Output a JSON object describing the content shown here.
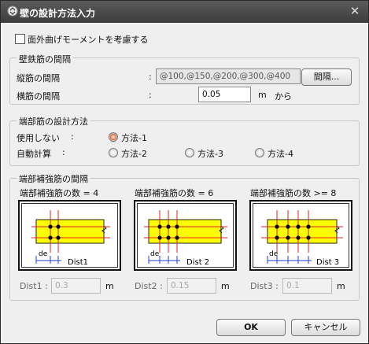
{
  "window": {
    "title": "壁の設計方法入力",
    "close_glyph": "✕"
  },
  "out_of_plane": {
    "label": "面外曲げモーメントを考慮する",
    "checked": false
  },
  "wall_rebar": {
    "group_title": "壁鉄筋の間隔",
    "vertical": {
      "label": "縦筋の間隔",
      "colon": ":",
      "value": "@100,@150,@200,@300,@400",
      "button": "間隔..."
    },
    "horizontal": {
      "label": "横筋の間隔",
      "colon": ":",
      "value": "0.05",
      "unit": "m",
      "suffix": "から"
    }
  },
  "end_rebar_design": {
    "group_title": "端部筋の設計方法",
    "manual": {
      "label": "使用しない",
      "colon": ":"
    },
    "auto": {
      "label": "自動計算",
      "colon": ":"
    },
    "methods": [
      {
        "label": "方法-1",
        "selected": true
      },
      {
        "label": "方法-2",
        "selected": false
      },
      {
        "label": "方法-3",
        "selected": false
      },
      {
        "label": "方法-4",
        "selected": false
      }
    ]
  },
  "end_reinforce_spacing": {
    "group_title": "端部補強筋の間隔",
    "cases": [
      {
        "caption": "端部補強筋の数 = 4",
        "de": "de",
        "dist_label": "Dist1",
        "field_label": "Dist1 :",
        "value": "0.3",
        "unit": "m"
      },
      {
        "caption": "端部補強筋の数 = 6",
        "de": "de",
        "dist_label": "Dist 2",
        "field_label": "Dist2 :",
        "value": "0.15",
        "unit": "m"
      },
      {
        "caption": "端部補強筋の数 >= 8",
        "de": "de",
        "dist_label": "Dist 3",
        "field_label": "Dist3 :",
        "value": "0.1",
        "unit": "m"
      }
    ]
  },
  "footer": {
    "ok": "OK",
    "cancel": "キャンセル"
  },
  "colors": {
    "beam": "#ffff00",
    "red_line": "#e02020",
    "blue_dim": "#1d3fd0",
    "radio_selected": "#e0522a"
  }
}
